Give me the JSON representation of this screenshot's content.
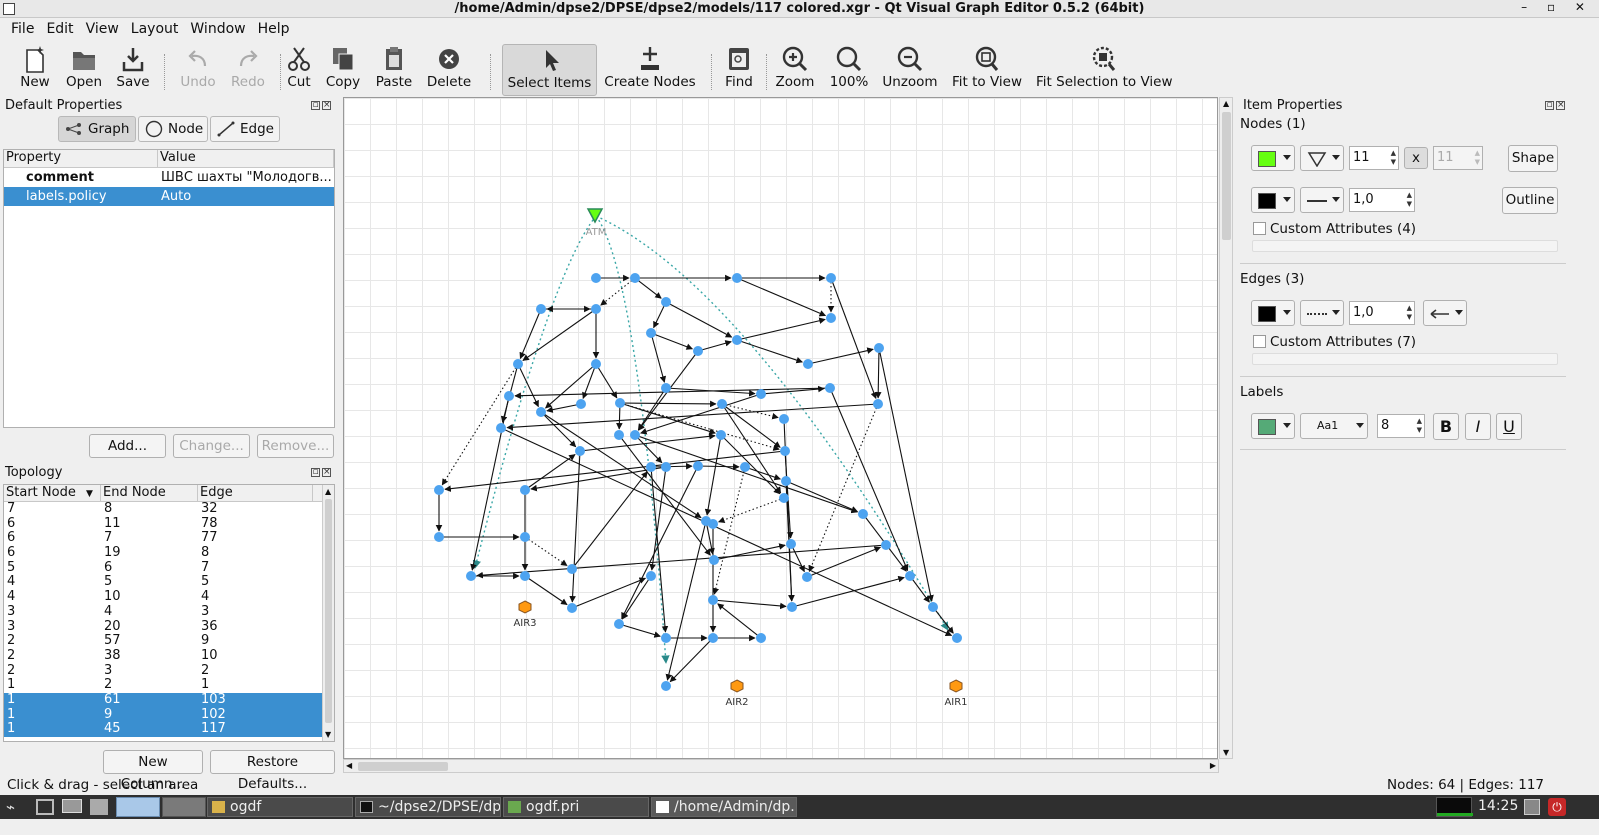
{
  "window": {
    "title": "/home/Admin/dpse2/DPSE/dpse2/models/117 colored.xgr - Qt Visual Graph Editor 0.5.2 (64bit)",
    "controls": "–  ▫  ✕"
  },
  "menu": [
    "File",
    "Edit",
    "View",
    "Layout",
    "Window",
    "Help"
  ],
  "toolbar": {
    "new": "New",
    "open": "Open",
    "save": "Save",
    "undo": "Undo",
    "redo": "Redo",
    "cut": "Cut",
    "copy": "Copy",
    "paste": "Paste",
    "delete": "Delete",
    "select": "Select Items",
    "create": "Create Nodes",
    "find": "Find",
    "zoom": "Zoom",
    "zoom100": "100%",
    "unzoom": "Unzoom",
    "fit": "Fit to View",
    "fitsel": "Fit Selection to View"
  },
  "default_properties": {
    "title": "Default Properties",
    "tabs": {
      "graph": "Graph",
      "node": "Node",
      "edge": "Edge"
    },
    "columns": {
      "property": "Property",
      "value": "Value"
    },
    "rows": [
      {
        "property": "comment",
        "value": "ШВС шахты \"Молодогв..."
      },
      {
        "property": "labels.policy",
        "value": "Auto"
      }
    ],
    "buttons": {
      "add": "Add...",
      "change": "Change...",
      "remove": "Remove..."
    }
  },
  "topology": {
    "title": "Topology",
    "columns": {
      "start": "Start Node",
      "end": "End Node",
      "edge": "Edge"
    },
    "rows": [
      [
        "7",
        "8",
        "32"
      ],
      [
        "6",
        "11",
        "78"
      ],
      [
        "6",
        "7",
        "77"
      ],
      [
        "6",
        "19",
        "8"
      ],
      [
        "5",
        "6",
        "7"
      ],
      [
        "4",
        "5",
        "5"
      ],
      [
        "4",
        "10",
        "4"
      ],
      [
        "3",
        "4",
        "3"
      ],
      [
        "3",
        "20",
        "36"
      ],
      [
        "2",
        "57",
        "9"
      ],
      [
        "2",
        "38",
        "10"
      ],
      [
        "2",
        "3",
        "2"
      ],
      [
        "1",
        "2",
        "1"
      ],
      [
        "1",
        "61",
        "103"
      ],
      [
        "1",
        "9",
        "102"
      ],
      [
        "1",
        "45",
        "117"
      ]
    ],
    "buttons": {
      "new_column": "New Column...",
      "restore": "Restore Defaults..."
    }
  },
  "graph": {
    "labels": {
      "atm": "ATM",
      "air1": "AIR1",
      "air2": "AIR2",
      "air3": "AIR3"
    }
  },
  "item_properties": {
    "title": "Item Properties",
    "nodes": {
      "title": "Nodes (1)",
      "size_w": "11",
      "size_h": "11",
      "x": "x",
      "shape_btn": "Shape",
      "outline_width": "1,0",
      "outline_btn": "Outline",
      "custom": "Custom Attributes (4)",
      "fill_color": "#66ff11"
    },
    "edges": {
      "title": "Edges (3)",
      "width": "1,0",
      "custom": "Custom Attributes (7)"
    },
    "labels": {
      "title": "Labels",
      "font": "Aa1",
      "size": "8",
      "bold": "B",
      "italic": "I",
      "underline": "U",
      "color": "#55aa77"
    }
  },
  "status": {
    "message": "Click & drag - select an area",
    "counts": "Nodes: 64 | Edges: 117"
  },
  "taskbar": {
    "tasks": [
      "ogdf",
      "~/dpse2/DPSE/dp...",
      "ogdf.pri",
      "/home/Admin/dp..."
    ],
    "clock": "14:25"
  }
}
